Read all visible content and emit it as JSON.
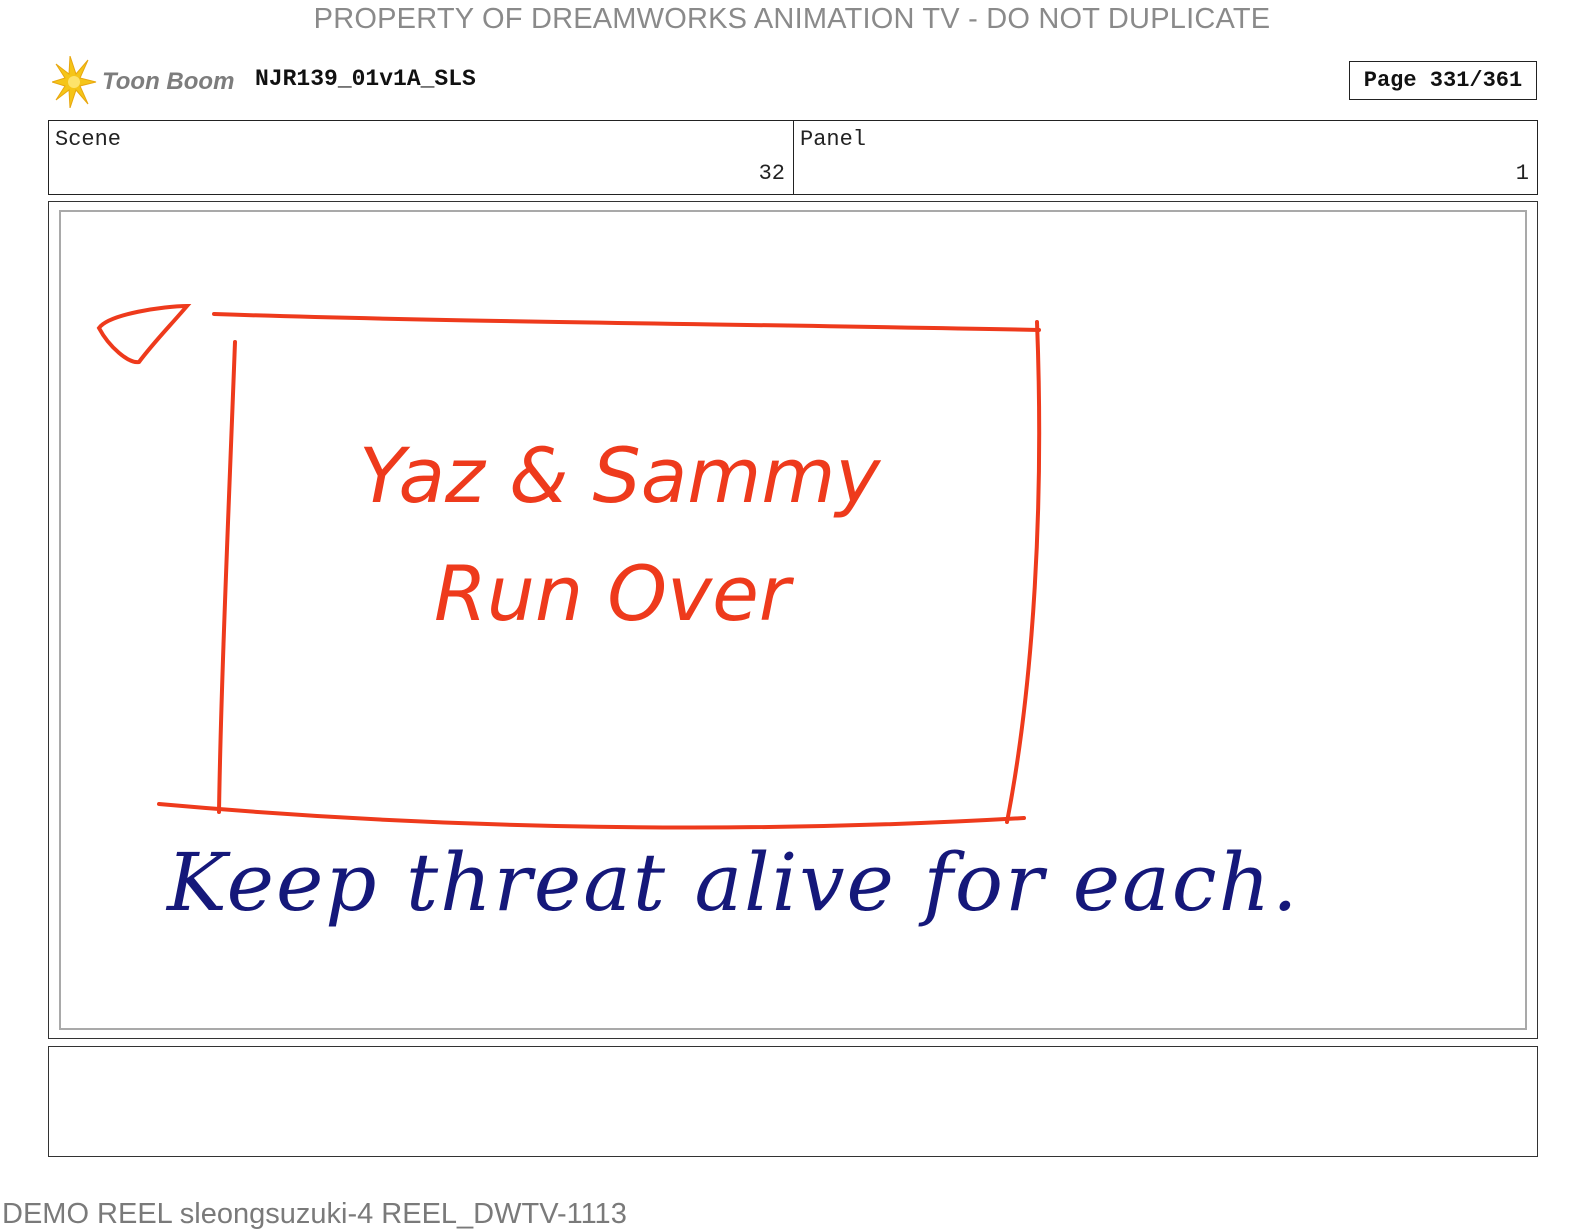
{
  "watermark": "PROPERTY OF DREAMWORKS ANIMATION TV - DO NOT DUPLICATE",
  "header": {
    "logo_text": "Toon Boom",
    "project_id": "NJR139_01v1A_SLS",
    "page_label": "Page 331/361"
  },
  "info": {
    "scene_label": "Scene",
    "scene_value": "32",
    "panel_label": "Panel",
    "panel_value": "1"
  },
  "panel": {
    "title_line1": "Yaz & Sammy",
    "title_line2": "Run Over",
    "note": "Keep threat alive for each."
  },
  "notes": {
    "text": ""
  },
  "footer": "DEMO REEL sleongsuzuki-4 REEL_DWTV-1113",
  "colors": {
    "sketch_red": "#ee3a1c",
    "sketch_blue": "#15187a",
    "logo_yellow": "#f5c518",
    "logo_text_gray": "#7d7d7d",
    "watermark_gray": "#8a8a8a"
  }
}
